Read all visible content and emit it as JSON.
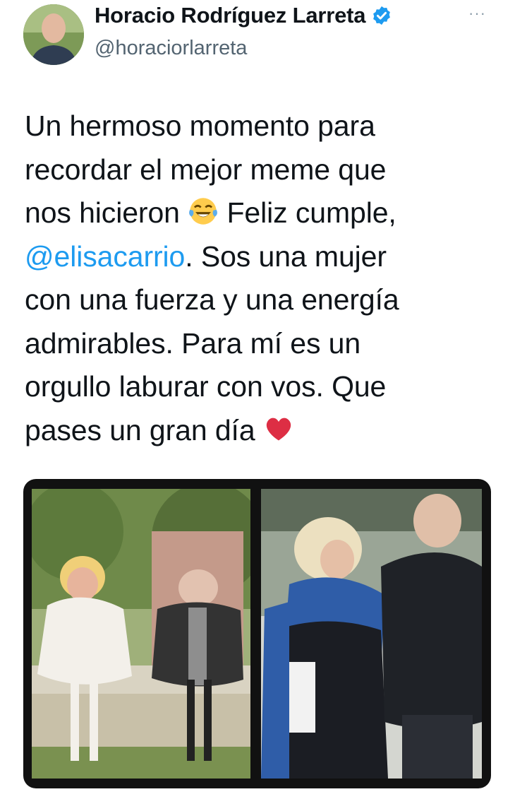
{
  "author": {
    "name": "Horacio Rodríguez Larreta",
    "handle": "@horaciorlarreta",
    "verified": true,
    "avatar_icon": "profile-photo",
    "more_icon": "more-icon"
  },
  "tweet": {
    "line1": "Un hermoso momento para",
    "line2": "recordar el mejor meme que",
    "line3_a": "nos hicieron",
    "line3_b": " Feliz cumple,",
    "mention": "@elisacarrio",
    "line4_b": ". Sos una mujer",
    "line5": "con una fuerza y una energía",
    "line6": "admirables. Para mí es un",
    "line7": "orgullo laburar con vos. Que",
    "line8_a": "pases un gran día",
    "emoji_laugh": "face-with-tears-of-joy-icon",
    "emoji_heart": "red-heart-icon"
  },
  "colors": {
    "link": "#1d9bf0",
    "verified": "#1d9bf0",
    "secondary_text": "#536471"
  }
}
